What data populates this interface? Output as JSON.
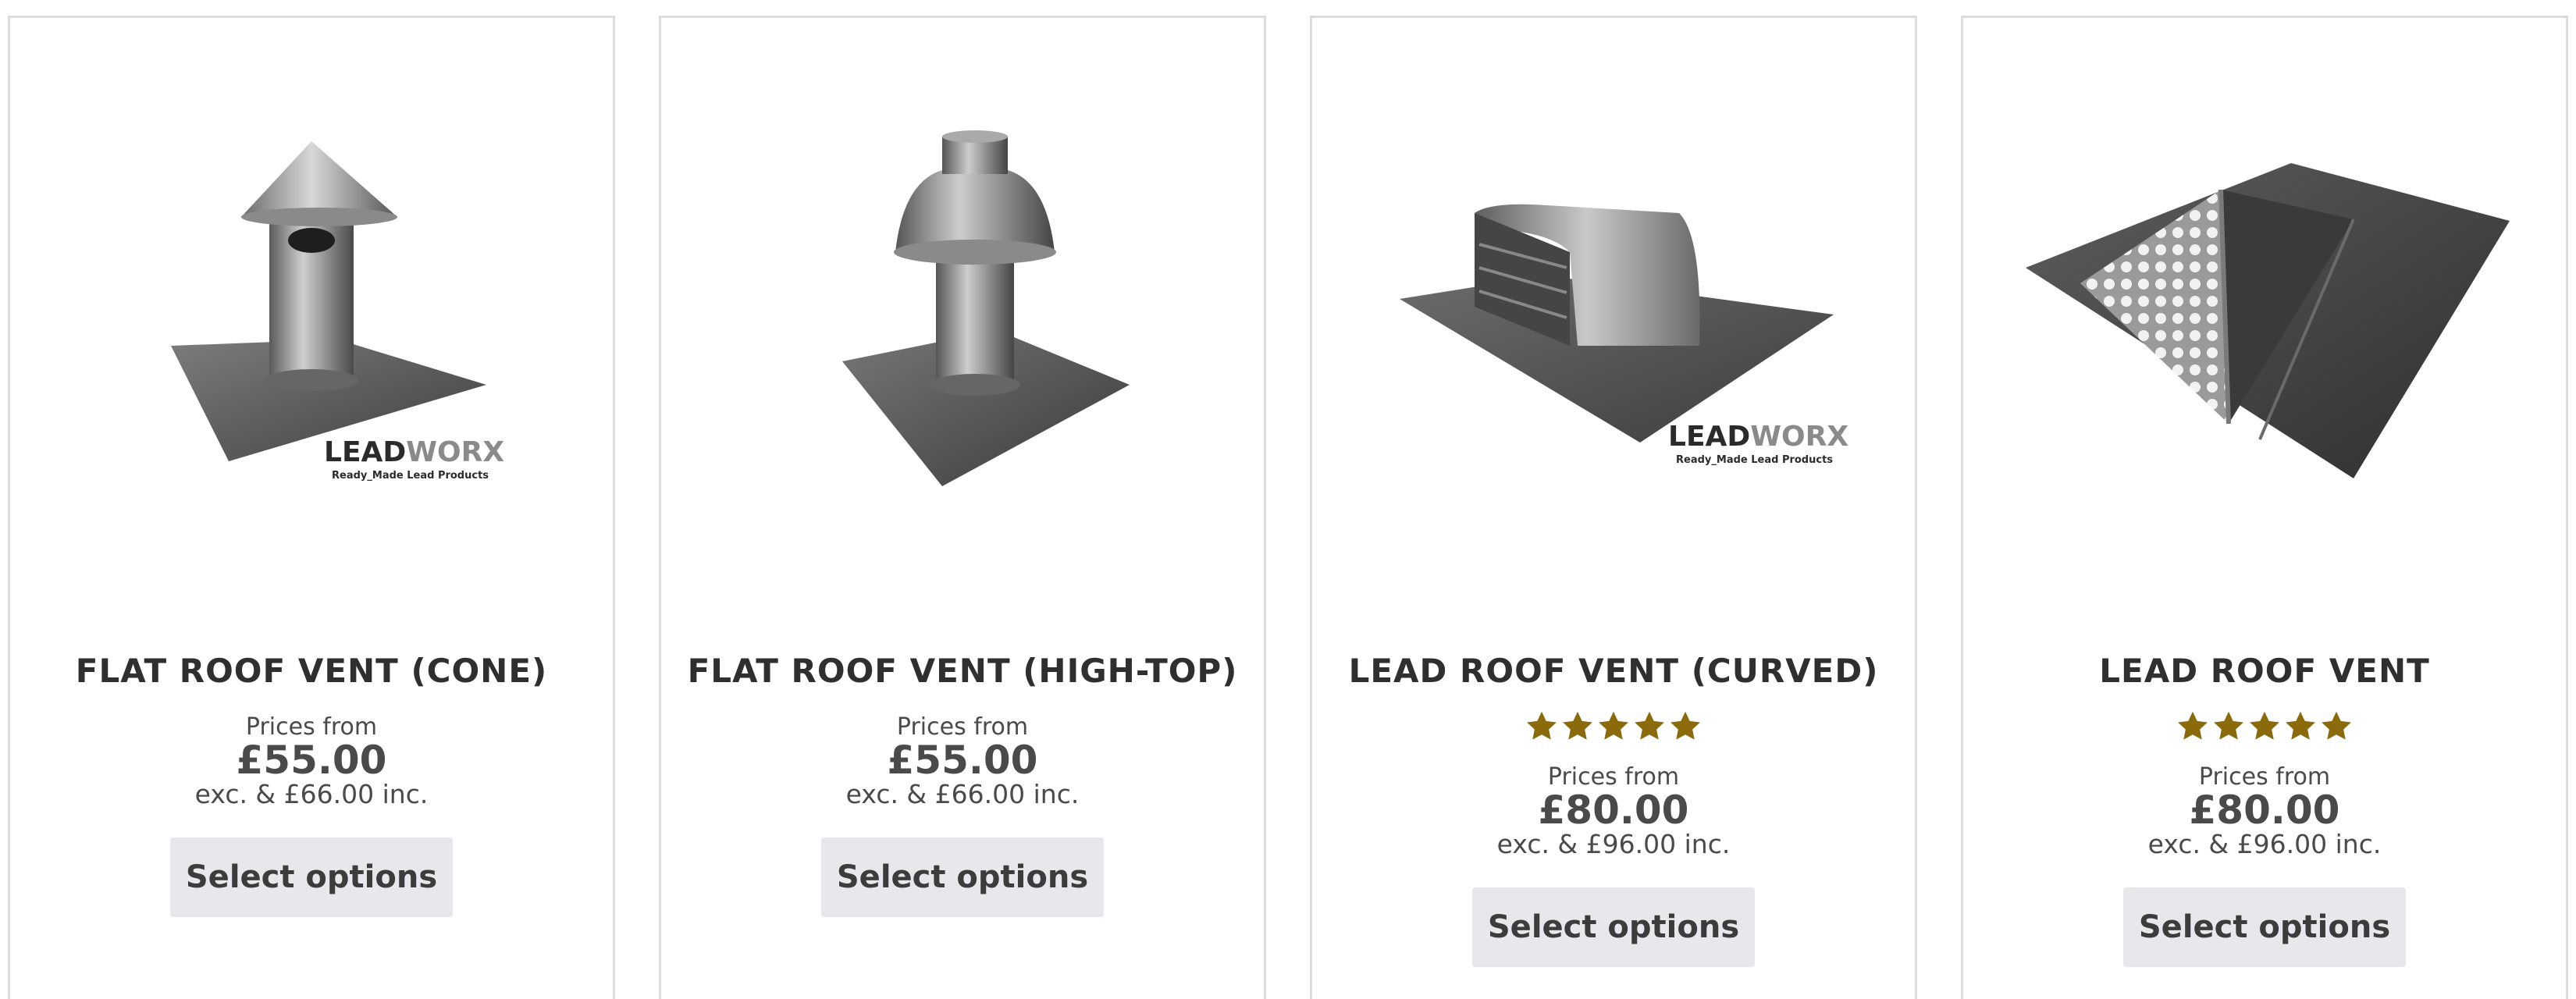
{
  "brand": {
    "logo_text_dark": "LEAD",
    "logo_text_light": "WORX",
    "logo_tagline": "Ready_Made Lead Products"
  },
  "colors": {
    "star": "#8a6a0a",
    "button_bg": "#e8e8ec",
    "card_border": "#dcdcdc"
  },
  "products": [
    {
      "title": "FLAT ROOF VENT (CONE)",
      "rating": null,
      "prices_from_label": "Prices from",
      "price": "£55.00",
      "inc_text": "exc. & £66.00 inc.",
      "button_label": "Select options",
      "image": "cone-roof-vent-image"
    },
    {
      "title": "FLAT ROOF VENT (HIGH-TOP)",
      "rating": null,
      "prices_from_label": "Prices from",
      "price": "£55.00",
      "inc_text": "exc. & £66.00 inc.",
      "button_label": "Select options",
      "image": "high-top-roof-vent-image"
    },
    {
      "title": "LEAD ROOF VENT (CURVED)",
      "rating": 5,
      "prices_from_label": "Prices from",
      "price": "£80.00",
      "inc_text": "exc. & £96.00 inc.",
      "button_label": "Select options",
      "image": "curved-roof-vent-image"
    },
    {
      "title": "LEAD ROOF VENT",
      "rating": 5,
      "prices_from_label": "Prices from",
      "price": "£80.00",
      "inc_text": "exc. & £96.00 inc.",
      "button_label": "Select options",
      "image": "triangular-roof-vent-image"
    }
  ]
}
